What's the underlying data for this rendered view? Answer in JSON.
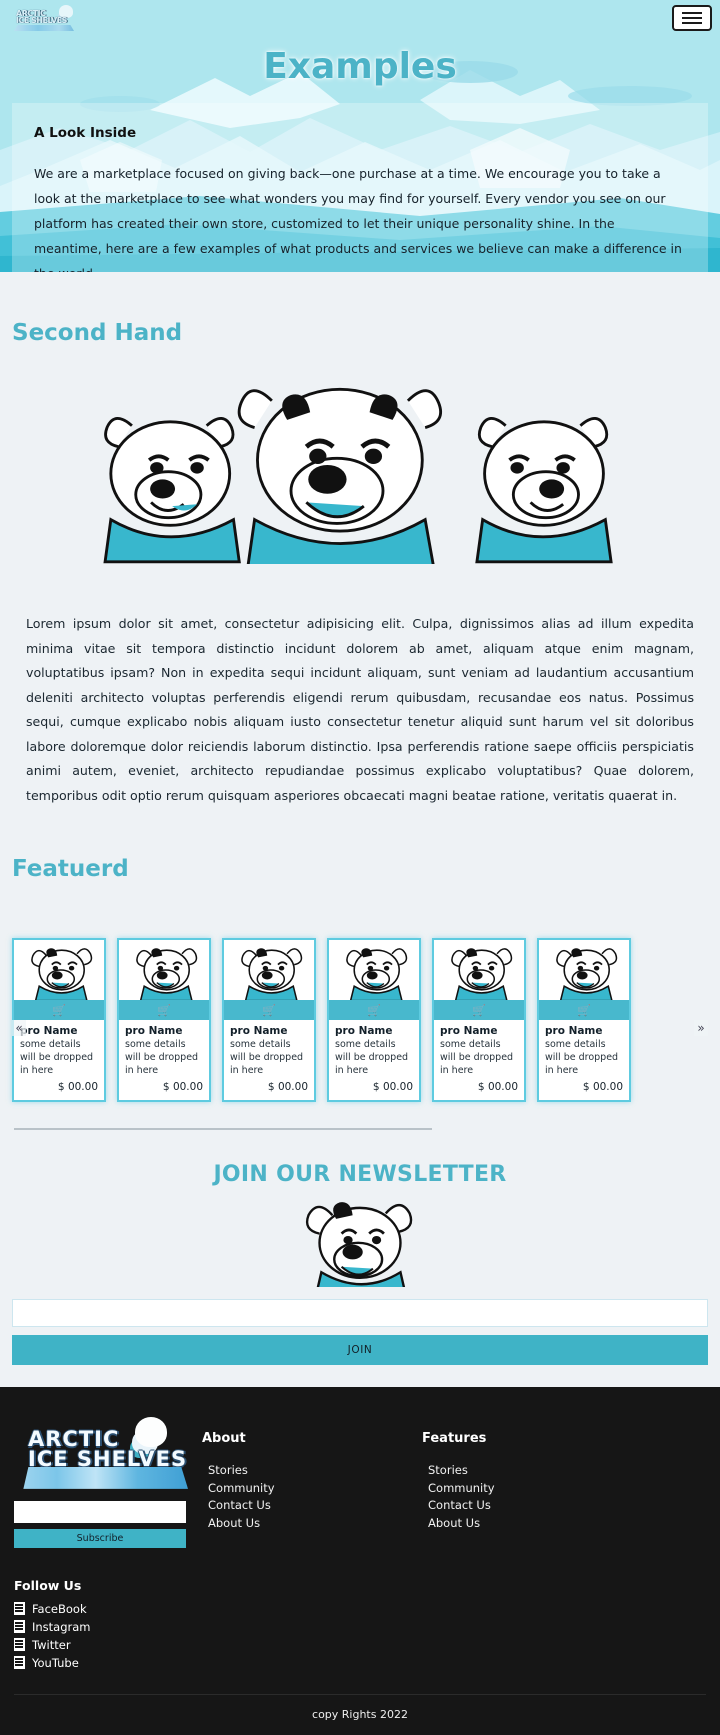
{
  "brand": {
    "logo_line1": "ARCTIC",
    "logo_line2": "ICE SHELVES",
    "menu_icon": "hamburger-menu-icon"
  },
  "hero": {
    "title": "Examples",
    "card_title": "A Look Inside",
    "card_body": "We are a marketplace focused on giving back—one purchase at a time. We encourage you to take a look at the marketplace to see what wonders you may find for yourself. Every vendor you see on our platform has created their own store, customized to let their unique personality shine. In the meantime, here are a few examples of what products and services we believe can make a difference in the world."
  },
  "second_hand": {
    "title": "Second Hand",
    "body": "Lorem ipsum dolor sit amet, consectetur adipisicing elit. Culpa, dignissimos alias ad illum expedita minima vitae sit tempora distinctio incidunt dolorem ab amet, aliquam atque enim magnam, voluptatibus ipsam? Non in expedita sequi incidunt aliquam, sunt veniam ad laudantium accusantium deleniti architecto voluptas perferendis eligendi rerum quibusdam, recusandae eos natus. Possimus sequi, cumque explicabo nobis aliquam iusto consectetur tenetur aliquid sunt harum vel sit doloribus labore doloremque dolor reiciendis laborum distinctio. Ipsa perferendis ratione saepe officiis perspiciatis animi autem, eveniet, architecto repudiandae possimus explicabo voluptatibus? Quae dolorem, temporibus odit optio rerum quisquam asperiores obcaecati magni beatae ratione, veritatis quaerat in."
  },
  "featured": {
    "title": "Featuerd",
    "prev_arrow": "«",
    "next_arrow": "»",
    "cart_icon": "shopping-cart-icon",
    "products": [
      {
        "name": "pro Name",
        "desc": "some details will be dropped in here",
        "price": "$ 00.00"
      },
      {
        "name": "pro Name",
        "desc": "some details will be dropped in here",
        "price": "$ 00.00"
      },
      {
        "name": "pro Name",
        "desc": "some details will be dropped in here",
        "price": "$ 00.00"
      },
      {
        "name": "pro Name",
        "desc": "some details will be dropped in here",
        "price": "$ 00.00"
      },
      {
        "name": "pro Name",
        "desc": "some details will be dropped in here",
        "price": "$ 00.00"
      },
      {
        "name": "pro Name",
        "desc": "some details will be dropped in here",
        "price": "$ 00.00"
      }
    ]
  },
  "newsletter": {
    "title": "JOIN OUR NEWSLETTER",
    "input_placeholder": "",
    "input_value": "",
    "button_label": "JOIN"
  },
  "footer": {
    "logo_line1": "ARCTIC",
    "logo_line2": "ICE SHELVES",
    "subscribe_value": "",
    "subscribe_placeholder": "",
    "subscribe_button": "Subscribe",
    "columns": [
      {
        "heading": "About",
        "links": [
          "Stories",
          "Community",
          "Contact Us",
          "About Us"
        ]
      },
      {
        "heading": "Features",
        "links": [
          "Stories",
          "Community",
          "Contact Us",
          "About Us"
        ]
      }
    ],
    "follow_heading": "Follow Us",
    "socials": [
      {
        "label": "FaceBook",
        "icon": "facebook-icon"
      },
      {
        "label": "Instagram",
        "icon": "instagram-icon"
      },
      {
        "label": "Twitter",
        "icon": "twitter-icon"
      },
      {
        "label": "YouTube",
        "icon": "youtube-icon"
      }
    ],
    "copyright": "copy Rights 2022"
  },
  "colors": {
    "accent": "#4cb3c7",
    "accent_bar": "#48b8cd",
    "hero_bg": "#aee6ee",
    "page_bg": "#eef2f5",
    "footer_bg": "#161616"
  }
}
